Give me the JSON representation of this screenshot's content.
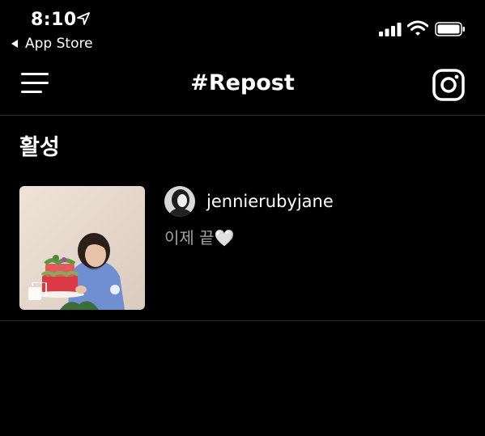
{
  "status_bar": {
    "time": "8:10",
    "back_label": "App Store",
    "icons": [
      "location-arrow-icon",
      "signal-icon",
      "wifi-icon",
      "battery-icon"
    ]
  },
  "nav": {
    "title": "#Repost",
    "left_icon": "menu-icon",
    "right_icon": "instagram-icon"
  },
  "section": {
    "title": "활성"
  },
  "posts": [
    {
      "username": "jennierubyjane",
      "caption": "이제 끝🤍",
      "media_badge": "multiple-photos-icon"
    }
  ],
  "colors": {
    "background": "#000000",
    "text": "#ffffff",
    "caption": "#a0a0a0",
    "divider": "#2c2c2e"
  }
}
